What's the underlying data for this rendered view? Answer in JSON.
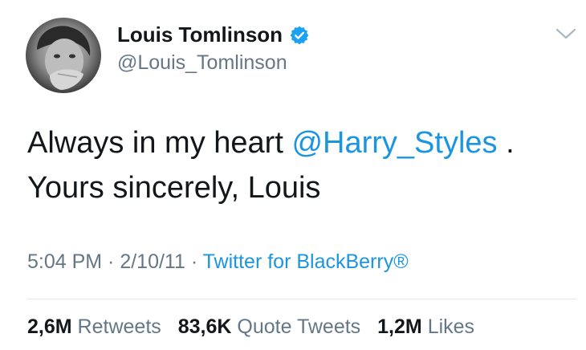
{
  "author": {
    "name": "Louis Tomlinson",
    "handle": "@Louis_Tomlinson",
    "verified": true
  },
  "tweet": {
    "line1_text": "Always in my heart ",
    "mention": "@Harry_Styles",
    "line1_after": " .",
    "line2_text": "Yours sincerely, Louis"
  },
  "meta": {
    "time": "5:04 PM",
    "separator1": " · ",
    "date": "2/10/11",
    "separator2": " · ",
    "source": "Twitter for BlackBerry®"
  },
  "stats": {
    "retweets_count": "2,6M",
    "retweets_label": "Retweets",
    "quotes_count": "83,6K",
    "quotes_label": "Quote Tweets",
    "likes_count": "1,2M",
    "likes_label": "Likes"
  },
  "colors": {
    "link": "#1b95e0",
    "secondary_text": "#657786",
    "verified_badge": "#1da1f2"
  }
}
